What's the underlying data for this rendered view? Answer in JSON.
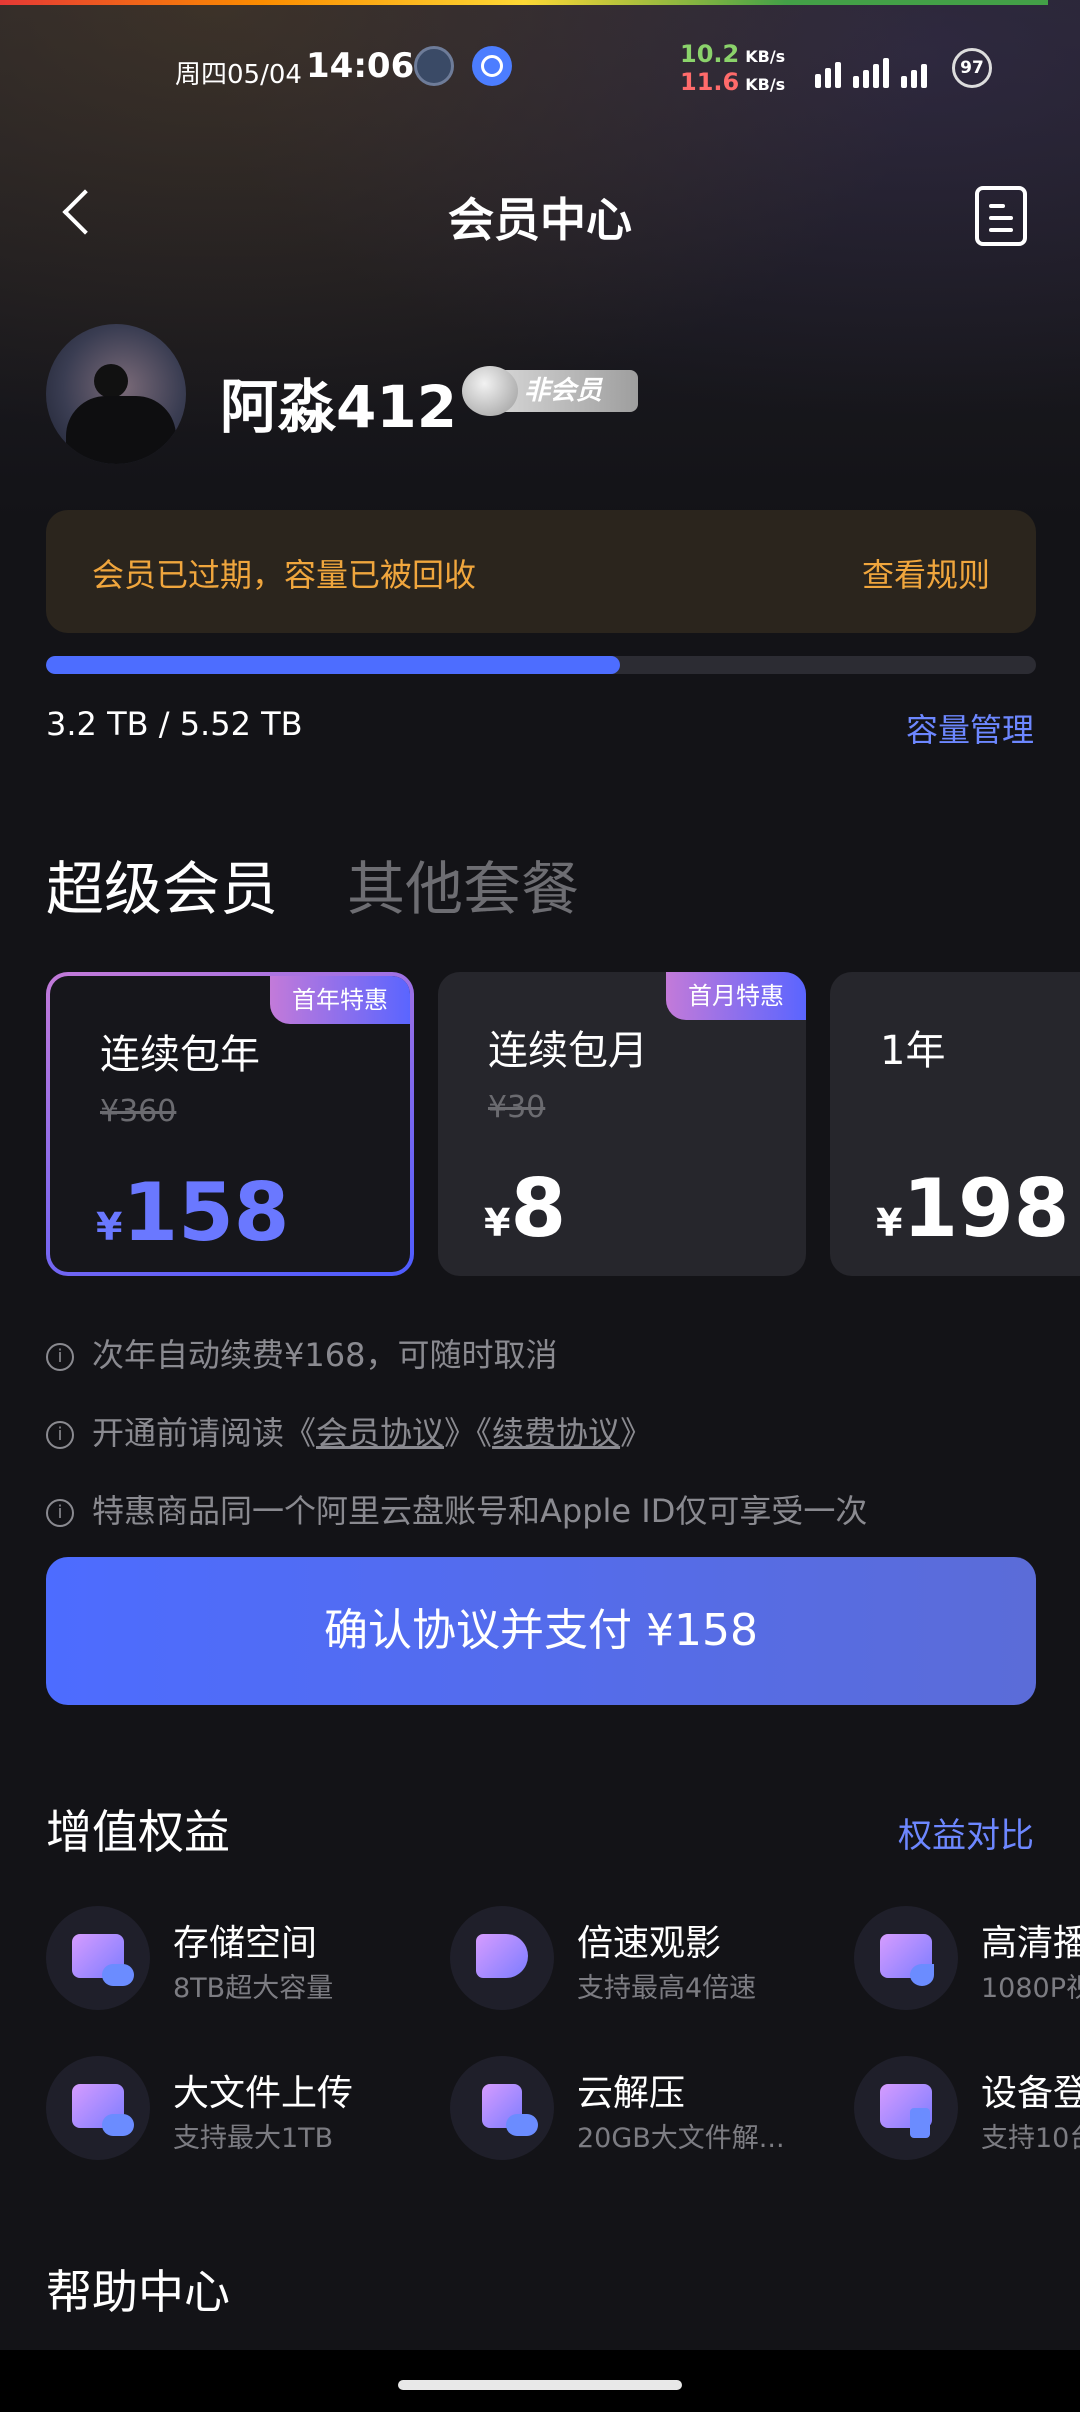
{
  "status_bar": {
    "date": "周四05/04",
    "time": "14:06",
    "down_speed": "10.2",
    "up_speed": "11.6",
    "speed_unit": "KB/s",
    "battery": "97"
  },
  "header": {
    "title": "会员中心"
  },
  "profile": {
    "username": "阿淼412",
    "badge": "非会员"
  },
  "notice": {
    "message": "会员已过期，容量已被回收",
    "action": "查看规则"
  },
  "storage": {
    "used_text": "3.2 TB / 5.52 TB",
    "fraction_used": 0.58,
    "manage_label": "容量管理"
  },
  "plan_tabs": {
    "active": "超级会员",
    "inactive": "其他套餐"
  },
  "plans": [
    {
      "name": "连续包年",
      "original": "¥360",
      "currency": "¥",
      "price": "158",
      "ribbon": "首年特惠",
      "selected": true
    },
    {
      "name": "连续包月",
      "original": "¥30",
      "currency": "¥",
      "price": "8",
      "ribbon": "首月特惠",
      "selected": false
    },
    {
      "name": "1年",
      "original": "",
      "currency": "¥",
      "price": "198",
      "ribbon": "",
      "selected": false
    }
  ],
  "notes": {
    "renewal": "次年自动续费¥168，可随时取消",
    "read_prefix": "开通前请阅读《",
    "member_agreement": "会员协议",
    "mid": "》《",
    "renew_agreement": "续费协议",
    "suffix": "》",
    "limit": "特惠商品同一个阿里云盘账号和Apple ID仅可享受一次"
  },
  "pay_button": "确认协议并支付 ¥158",
  "benefits": {
    "title": "增值权益",
    "compare": "权益对比",
    "items": [
      {
        "title": "存储空间",
        "desc": "8TB超大容量",
        "icon": "storage-icon"
      },
      {
        "title": "倍速观影",
        "desc": "支持最高4倍速",
        "icon": "speed-play-icon"
      },
      {
        "title": "高清播",
        "desc": "1080P视",
        "icon": "hd-play-icon"
      },
      {
        "title": "大文件上传",
        "desc": "支持最大1TB",
        "icon": "upload-icon"
      },
      {
        "title": "云解压",
        "desc": "20GB大文件解...",
        "icon": "unzip-icon"
      },
      {
        "title": "设备登",
        "desc": "支持10台",
        "icon": "devices-icon"
      }
    ]
  },
  "help": {
    "title": "帮助中心"
  }
}
